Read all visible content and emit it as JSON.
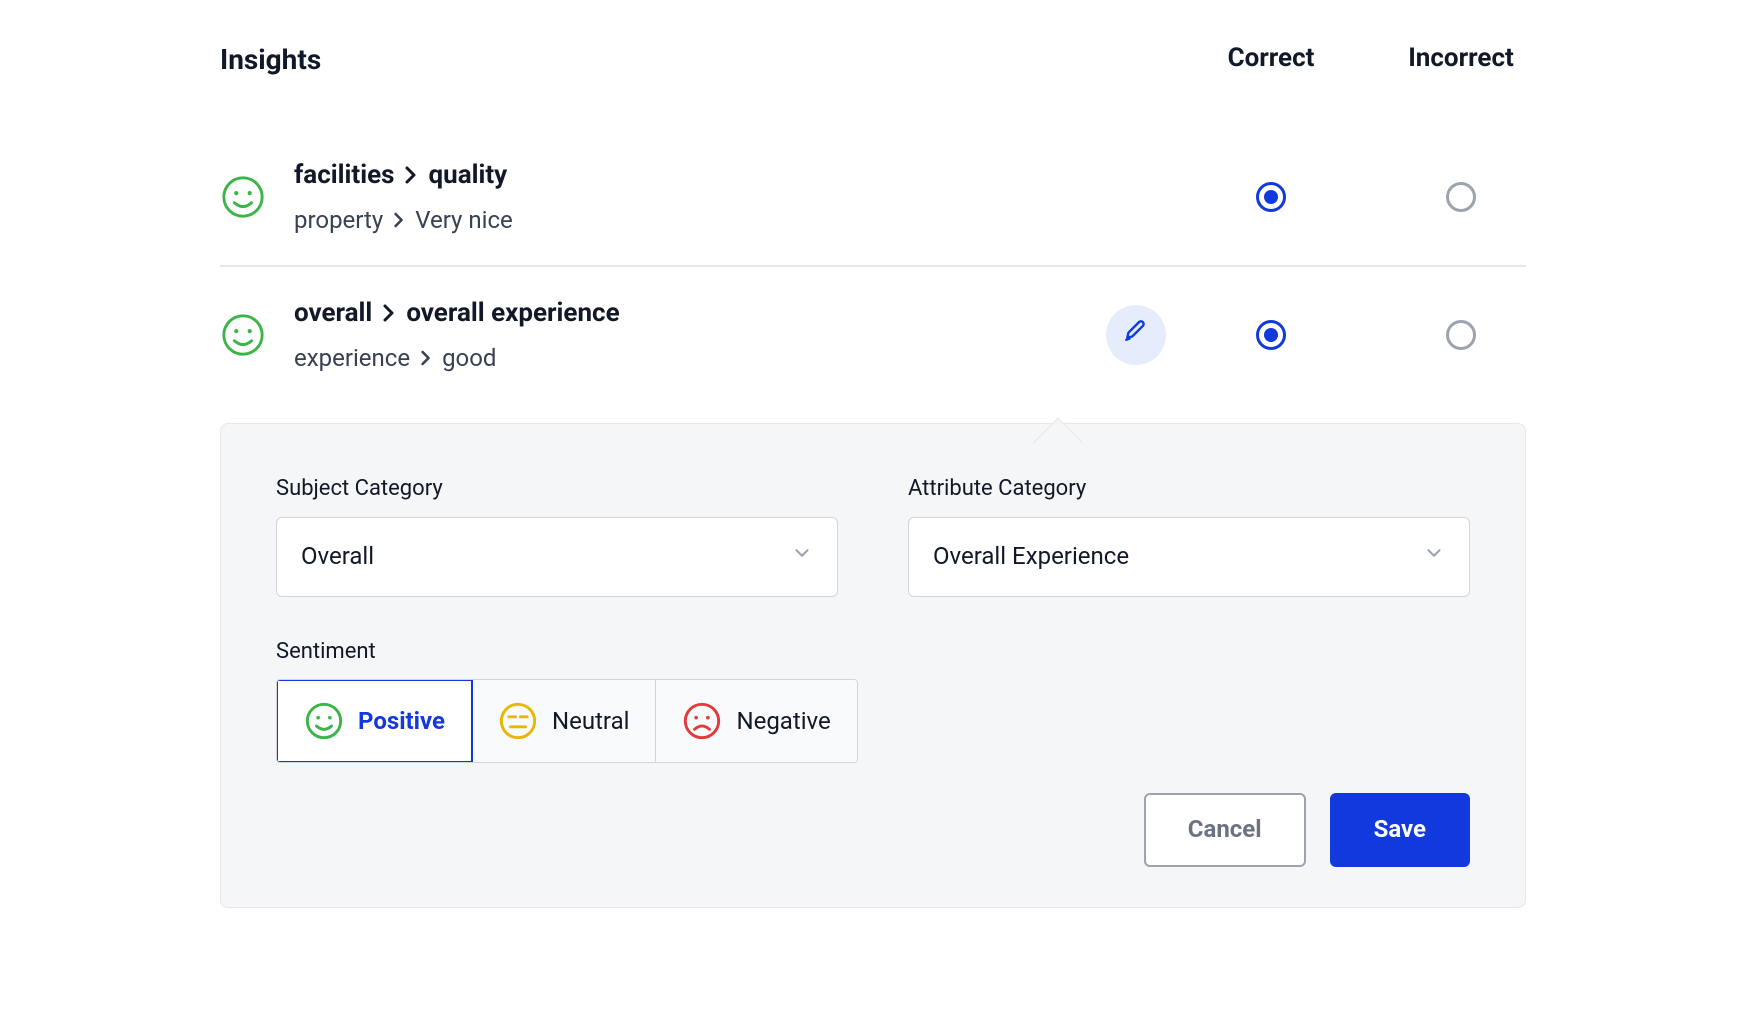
{
  "header": {
    "title": "Insights",
    "columns": {
      "correct": "Correct",
      "incorrect": "Incorrect"
    }
  },
  "insights": [
    {
      "sentiment": "positive",
      "category": "facilities",
      "attribute": "quality",
      "subject": "property",
      "value": "Very nice",
      "selection": "correct",
      "editing": false
    },
    {
      "sentiment": "positive",
      "category": "overall",
      "attribute": "overall experience",
      "subject": "experience",
      "value": "good",
      "selection": "correct",
      "editing": true
    }
  ],
  "editor": {
    "subject_label": "Subject Category",
    "subject_value": "Overall",
    "attribute_label": "Attribute Category",
    "attribute_value": "Overall Experience",
    "sentiment_label": "Sentiment",
    "sentiments": {
      "positive": "Positive",
      "neutral": "Neutral",
      "negative": "Negative"
    },
    "selected_sentiment": "positive",
    "cancel": "Cancel",
    "save": "Save"
  }
}
